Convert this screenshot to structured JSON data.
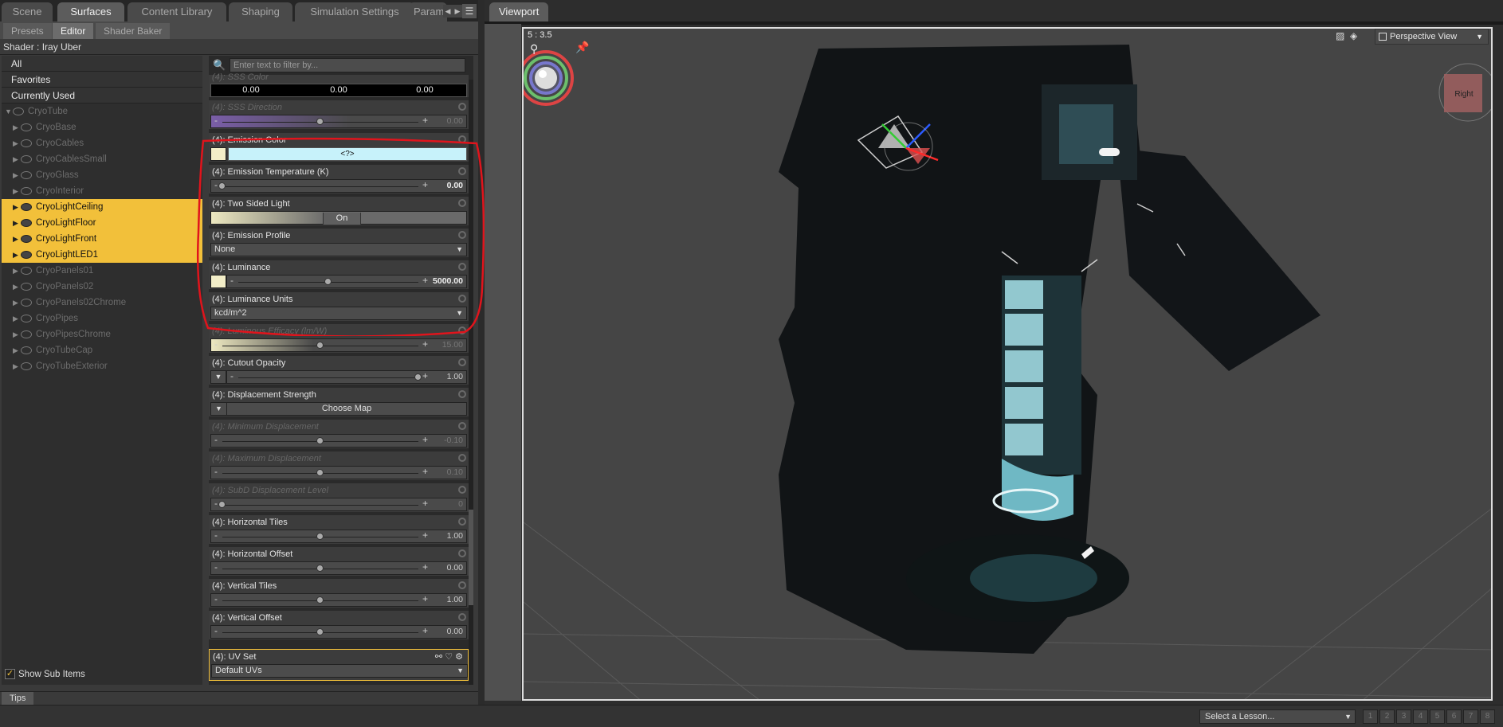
{
  "tabs": [
    "Scene",
    "Surfaces",
    "Content Library",
    "Shaping",
    "Simulation Settings",
    "Param"
  ],
  "subtabs": [
    "Presets",
    "Editor",
    "Shader Baker"
  ],
  "shader_line": "Shader : Iray Uber",
  "categories": [
    "All",
    "Favorites",
    "Currently Used"
  ],
  "tree": {
    "root": "CryoTube",
    "items": [
      "CryoBase",
      "CryoCables",
      "CryoCablesSmall",
      "CryoGlass",
      "CryoInterior",
      "CryoLightCeiling",
      "CryoLightFloor",
      "CryoLightFront",
      "CryoLightLED1",
      "CryoPanels01",
      "CryoPanels02",
      "CryoPanels02Chrome",
      "CryoPipes",
      "CryoPipesChrome",
      "CryoTubeCap",
      "CryoTubeExterior"
    ],
    "selected": [
      "CryoLightCeiling",
      "CryoLightFloor",
      "CryoLightFront",
      "CryoLightLED1"
    ]
  },
  "show_sub_items": "Show Sub Items",
  "filter_placeholder": "Enter text to filter by...",
  "props": {
    "sss_color": {
      "label": "(4): SSS Color",
      "v1": "0.00",
      "v2": "0.00",
      "v3": "0.00"
    },
    "sss_direction": {
      "label": "(4): SSS Direction",
      "value": "0.00",
      "level": 0.5
    },
    "emission_color": {
      "label": "(4): Emission Color",
      "value": "<?>",
      "swatch": "#f3eec8",
      "color": "#c7f2fa"
    },
    "emission_temp": {
      "label": "(4): Emission Temperature (K)",
      "value": "0.00",
      "level": 0.0
    },
    "two_sided": {
      "label": "(4): Two Sided Light",
      "value": "On"
    },
    "emission_profile": {
      "label": "(4): Emission Profile",
      "value": "None"
    },
    "luminance": {
      "label": "(4): Luminance",
      "value": "5000.00",
      "level": 0.5
    },
    "luminance_units": {
      "label": "(4): Luminance Units",
      "value": "kcd/m^2"
    },
    "luminous_efficacy": {
      "label": "(4): Luminous Efficacy (lm/W)",
      "value": "15.00",
      "level": 0.5
    },
    "cutout_opacity": {
      "label": "(4): Cutout Opacity",
      "value": "1.00",
      "level": 1.0
    },
    "displacement_strength": {
      "label": "(4): Displacement Strength",
      "value": "Choose Map"
    },
    "min_displacement": {
      "label": "(4): Minimum Displacement",
      "value": "-0.10",
      "level": 0.5
    },
    "max_displacement": {
      "label": "(4): Maximum Displacement",
      "value": "0.10",
      "level": 0.5
    },
    "subd_level": {
      "label": "(4): SubD Displacement Level",
      "value": "0",
      "level": 0.0
    },
    "horizontal_tiles": {
      "label": "(4): Horizontal Tiles",
      "value": "1.00",
      "level": 0.5
    },
    "horizontal_offset": {
      "label": "(4): Horizontal Offset",
      "value": "0.00",
      "level": 0.5
    },
    "vertical_tiles": {
      "label": "(4): Vertical Tiles",
      "value": "1.00",
      "level": 0.5
    },
    "vertical_offset": {
      "label": "(4): Vertical Offset",
      "value": "0.00",
      "level": 0.5
    },
    "uv_set": {
      "label": "(4): UV Set",
      "value": "Default UVs"
    }
  },
  "tips": "Tips",
  "viewport": {
    "tab": "Viewport",
    "ratio": "5 : 3.5",
    "view": "Perspective View",
    "cube_face": "Right",
    "bg_color": "#454545"
  },
  "status": {
    "lesson": "Select a Lesson...",
    "pages": [
      "1",
      "2",
      "3",
      "4",
      "5",
      "6",
      "7",
      "8"
    ]
  },
  "colors": {
    "selection": "#f2c03a",
    "annotation": "#e0141c",
    "emission": "#9fd8e0"
  }
}
